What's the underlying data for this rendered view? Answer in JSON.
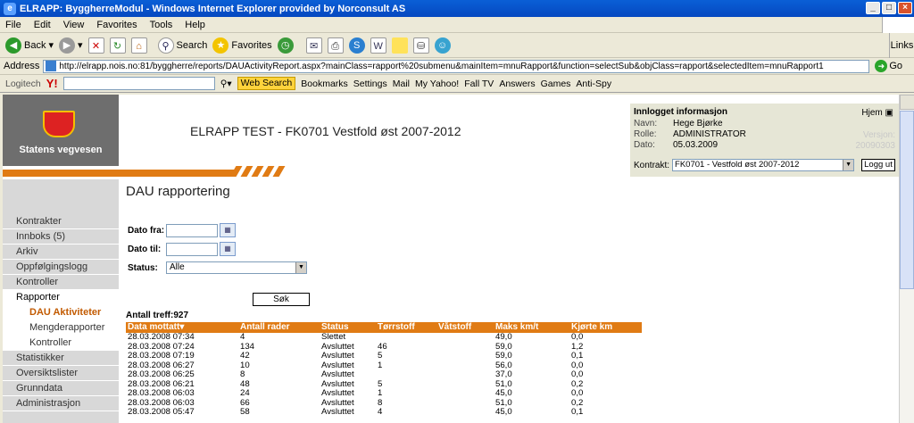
{
  "window": {
    "title": "ELRAPP: ByggherreModul - Windows Internet Explorer provided by Norconsult AS",
    "buttons": [
      "_",
      "□",
      "×"
    ]
  },
  "menu": [
    "File",
    "Edit",
    "View",
    "Favorites",
    "Tools",
    "Help"
  ],
  "toolbar": {
    "back": "Back",
    "search": "Search",
    "favorites": "Favorites",
    "links": "Links"
  },
  "address": {
    "label": "Address",
    "url": "http://elrapp.nois.no:81/byggherre/reports/DAUActivityReport.aspx?mainClass=rapport%20submenu&mainItem=mnuRapport&function=selectSub&objClass=rapport&selectedItem=mnuRapport1",
    "go": "Go"
  },
  "yahoo_toolbar": [
    "Logitech",
    "Y!",
    "Web Search",
    "Bookmarks",
    "Settings",
    "Mail",
    "My Yahoo!",
    "Fall TV",
    "Answers",
    "Games",
    "Anti-Spy"
  ],
  "brand": {
    "name": "Statens vegvesen",
    "title": "ELRAPP TEST - FK0701 Vestfold øst 2007-2012"
  },
  "info": {
    "heading": "Innlogget informasjon",
    "home": "Hjem",
    "fields": [
      {
        "k": "Navn:",
        "v": "Hege Bjørke"
      },
      {
        "k": "Rolle:",
        "v": "ADMINISTRATOR"
      },
      {
        "k": "Dato:",
        "v": "05.03.2009"
      }
    ],
    "version_label": "Versjon:",
    "version": "20090303",
    "kontrakt_label": "Kontrakt:",
    "kontrakt_value": "FK0701 - Vestfold øst 2007-2012",
    "logout": "Logg ut"
  },
  "sidebar": {
    "items": [
      "Kontrakter",
      "Innboks (5)",
      "Arkiv",
      "Oppfølgingslogg",
      "Kontroller",
      "Rapporter"
    ],
    "sub_items": [
      "DAU Aktiviteter",
      "Mengderapporter",
      "Kontroller"
    ],
    "items2": [
      "Statistikker",
      "Oversiktslister",
      "Grunndata",
      "Administrasjon"
    ]
  },
  "main": {
    "title": "DAU rapportering",
    "date_from_label": "Dato fra:",
    "date_to_label": "Dato til:",
    "status_label": "Status:",
    "status_value": "Alle",
    "search_button": "Søk",
    "hit_count": "Antall treff:927"
  },
  "table": {
    "headers": [
      "Data mottatt",
      "Antall rader",
      "Status",
      "Tørrstoff",
      "Våtstoff",
      "Maks km/t",
      "Kjørte km"
    ],
    "rows": [
      [
        "28.03.2008 07:34",
        "4",
        "Slettet",
        "",
        "",
        "49,0",
        "0,0"
      ],
      [
        "28.03.2008 07:24",
        "134",
        "Avsluttet",
        "46",
        "",
        "59,0",
        "1,2"
      ],
      [
        "28.03.2008 07:19",
        "42",
        "Avsluttet",
        "5",
        "",
        "59,0",
        "0,1"
      ],
      [
        "28.03.2008 06:27",
        "10",
        "Avsluttet",
        "1",
        "",
        "56,0",
        "0,0"
      ],
      [
        "28.03.2008 06:25",
        "8",
        "Avsluttet",
        "",
        "",
        "37,0",
        "0,0"
      ],
      [
        "28.03.2008 06:21",
        "48",
        "Avsluttet",
        "5",
        "",
        "51,0",
        "0,2"
      ],
      [
        "28.03.2008 06:03",
        "24",
        "Avsluttet",
        "1",
        "",
        "45,0",
        "0,0"
      ],
      [
        "28.03.2008 06:03",
        "66",
        "Avsluttet",
        "8",
        "",
        "51,0",
        "0,2"
      ],
      [
        "28.03.2008 05:47",
        "58",
        "Avsluttet",
        "4",
        "",
        "45,0",
        "0,1"
      ]
    ]
  }
}
